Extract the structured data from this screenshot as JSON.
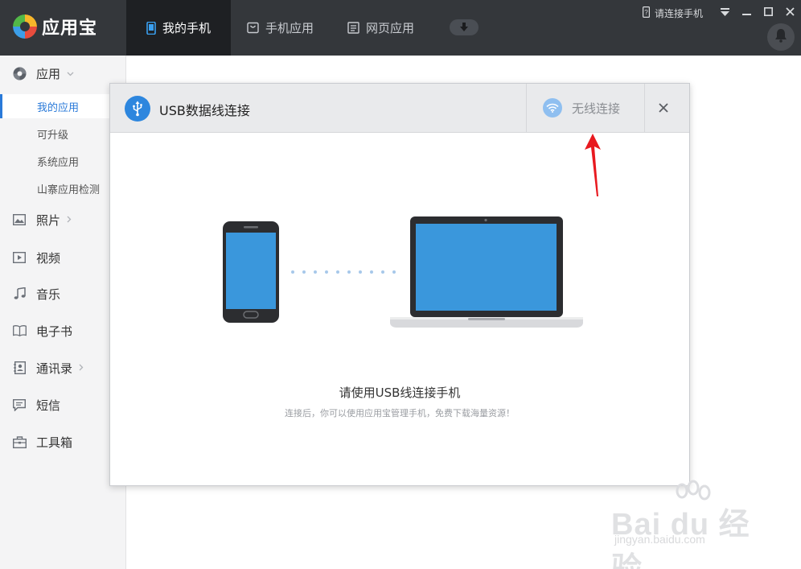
{
  "app": {
    "name": "应用宝"
  },
  "nav": {
    "tabs": [
      {
        "label": "我的手机",
        "active": true
      },
      {
        "label": "手机应用",
        "active": false
      },
      {
        "label": "网页应用",
        "active": false
      }
    ]
  },
  "window": {
    "phone_status": "请连接手机"
  },
  "sidebar": {
    "apps": {
      "label": "应用",
      "children": [
        "我的应用",
        "可升级",
        "系统应用",
        "山寨应用检测"
      ],
      "active_child": "我的应用"
    },
    "items": [
      "照片",
      "视频",
      "音乐",
      "电子书",
      "通讯录",
      "短信",
      "工具箱"
    ]
  },
  "dialog": {
    "title": "USB数据线连接",
    "wifi_tab": "无线连接",
    "message": "请使用USB线连接手机",
    "sub_message": "连接后，你可以使用应用宝管理手机，免费下载海量资源！"
  },
  "watermark": {
    "brand": "Bai du 经验",
    "url": "jingyan.baidu.com"
  },
  "colors": {
    "accent": "#2d86de",
    "topbar": "#34373b",
    "arrow": "#e8191f",
    "screen": "#3a97dc"
  }
}
